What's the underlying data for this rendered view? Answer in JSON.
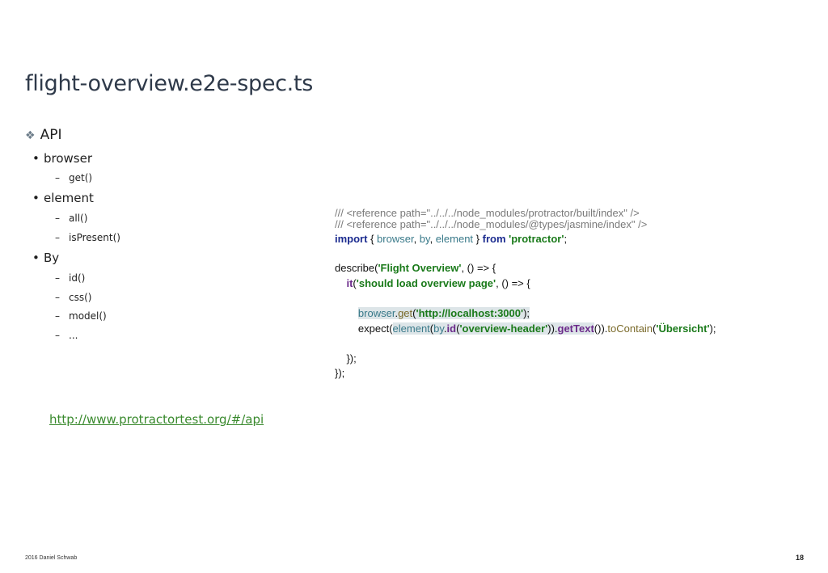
{
  "slide": {
    "title": "flight-overview.e2e-spec.ts",
    "bullets": {
      "api": "API",
      "browser": "browser",
      "browser_get": "get()",
      "element": "element",
      "element_all": "all()",
      "element_isPresent": "isPresent()",
      "by": "By",
      "by_id": "id()",
      "by_css": "css()",
      "by_model": "model()",
      "by_more": "..."
    },
    "link": "http://www.protractortest.org/#/api",
    "code": {
      "line1": "/// <reference path=\"../../../node_modules/protractor/built/index\" />",
      "line2": "/// <reference path=\"../../../node_modules/@types/jasmine/index\" />",
      "l3_import": "import",
      "l3_brace_open": " { ",
      "l3_browser": "browser",
      "l3_comma1": ", ",
      "l3_by": "by",
      "l3_comma2": ", ",
      "l3_element": "element",
      "l3_brace_close": " } ",
      "l3_from": "from",
      "l3_space": " ",
      "l3_module": "'protractor'",
      "l3_semi": ";",
      "l4_describe": "describe(",
      "l4_str": "'Flight Overview'",
      "l4_rest": ", () => {",
      "l5_indent": "    ",
      "l5_it": "it",
      "l5_paren": "(",
      "l5_str": "'should load overview page'",
      "l5_rest": ", () => {",
      "l6_indent": "        ",
      "l6_browser": "browser",
      "l6_dot": ".",
      "l6_get": "get",
      "l6_paren": "(",
      "l6_str": "'http://localhost:3000'",
      "l6_rest": ");",
      "l7_indent": "        ",
      "l7_expect": "expect(",
      "l7_element": "element",
      "l7_paren1": "(",
      "l7_by": "by",
      "l7_dot1": ".",
      "l7_id": "id",
      "l7_paren2": "(",
      "l7_str1": "'overview-header'",
      "l7_close": ")).",
      "l7_getText": "getText",
      "l7_close2": "()).",
      "l7_toContain": "toContain",
      "l7_paren3": "(",
      "l7_str2": "'Übersicht'",
      "l7_rest": ");",
      "l8": "    });",
      "l9": "});"
    },
    "footer": {
      "author": "2016 Daniel Schwab",
      "page": "18"
    }
  }
}
